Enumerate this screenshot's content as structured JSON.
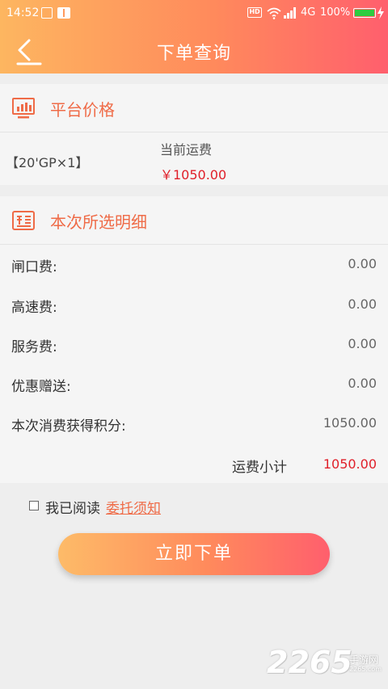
{
  "status": {
    "time": "14:52",
    "network": "4G",
    "battery": "100%",
    "battery_level": 1.0
  },
  "nav": {
    "title": "下单查询"
  },
  "platform_price": {
    "title": "平台价格",
    "container": "【20'GP×1】",
    "current_label": "当前运费",
    "current_value": "￥1050.00"
  },
  "details": {
    "title": "本次所选明细",
    "rows": [
      {
        "label": "闸口费:",
        "value": "0.00"
      },
      {
        "label": "高速费:",
        "value": "0.00"
      },
      {
        "label": "服务费:",
        "value": "0.00"
      },
      {
        "label": "优惠赠送:",
        "value": "0.00"
      },
      {
        "label": "本次消费获得积分:",
        "value": "1050.00"
      }
    ],
    "subtotal_label": "运费小计",
    "subtotal_value": "1050.00"
  },
  "agreement": {
    "text": "我已阅读",
    "link": "委托须知",
    "checked": false
  },
  "submit": {
    "label": "立即下单"
  },
  "watermark": {
    "number": "2265",
    "text": "手游网",
    "url": "2265.com"
  },
  "colors": {
    "accent": "#ef6b47",
    "price_red": "#e0202a",
    "grad_start": "#fdb660",
    "grad_end": "#ff5f6d"
  },
  "icons": {
    "back": "back-arrow-icon",
    "platform": "monitor-chart-icon",
    "details": "receipt-icon"
  }
}
